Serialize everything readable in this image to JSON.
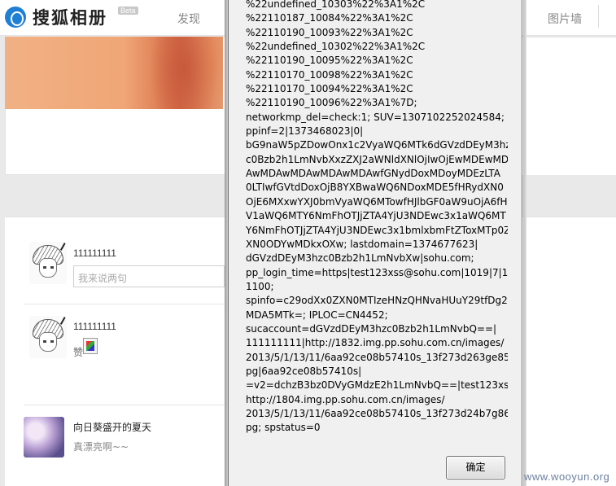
{
  "header": {
    "app_title": "搜狐相册",
    "beta_badge": "Beta",
    "nav_discover": "发现",
    "nav_photo_wall": "图片墙"
  },
  "feed": {
    "items": [
      {
        "username": "111111111",
        "comment_placeholder": "我来说两句"
      },
      {
        "username": "111111111",
        "like_text": "赞"
      },
      {
        "album_title": "向日葵盛开的夏天",
        "album_desc": "真漂亮啊~~"
      }
    ]
  },
  "dialog": {
    "lines": [
      "%22undefined_10303%22%3A1%2C",
      "%22110187_10084%22%3A1%2C",
      "%22110190_10093%22%3A1%2C",
      "%22undefined_10302%22%3A1%2C",
      "%22110190_10095%22%3A1%2C",
      "%22110170_10098%22%3A1%2C",
      "%22110170_10094%22%3A1%2C",
      "%22110190_10096%22%3A1%7D;",
      "networkmp_del=check:1; SUV=1307102252024584;",
      "ppinf=2|1373468023|0|",
      "bG9naW5pZDowOnx1c2VyaWQ6MTk6dGVzdDEyM3hz",
      "c0Bzb2h1LmNvbXxzZXJ2aWNldXNlOjIwOjEwMDEwMD",
      "AwMDAwMDAwMDAwMDAwfGNydDoxMDoyMDEzLTA",
      "0LTIwfGVtdDoxOjB8YXBwaWQ6NDoxMDE5fHRydXN0",
      "OjE6MXxwYXJ0bmVyaWQ6MTowfHJlbGF0aW9uOjA6fH",
      "V1aWQ6MTY6NmFhOTJjZTA4YjU3NDEwc3x1aWQ6MT",
      "Y6NmFhOTJjZTA4YjU3NDEwc3x1bmlxbmFtZToxMTp0Z",
      "XN0ODYwMDkxOXw; lastdomain=1374677623|",
      "dGVzdDEyM3hzc0Bzb2h1LmNvbXw|sohu.com;",
      "pp_login_time=https|test123xss@sohu.com|1019|7|19|",
      "1100;",
      "spinfo=c29odXx0ZXN0MTIzeHNzQHNvaHUuY29tfDg2",
      "MDA5MTk=; IPLOC=CN4452;",
      "sucaccount=dGVzdDEyM3hzc0Bzb2h1LmNvbQ==|",
      "111111111|http://1832.img.pp.sohu.com.cn/images/",
      "2013/5/1/13/11/6aa92ce08b57410s_13f273d263ge85.j",
      "pg|6aa92ce08b57410s|",
      "=v2=dchzB3bz0DVyGMdzE2h1LmNvbQ==|test123xss|",
      "http://1804.img.pp.sohu.com.cn/images/",
      "2013/5/1/13/11/6aa92ce08b57410s_13f273d24b7g86.j",
      "pg; spstatus=0"
    ],
    "ok_label": "确定"
  },
  "watermark": "www.wooyun.org"
}
